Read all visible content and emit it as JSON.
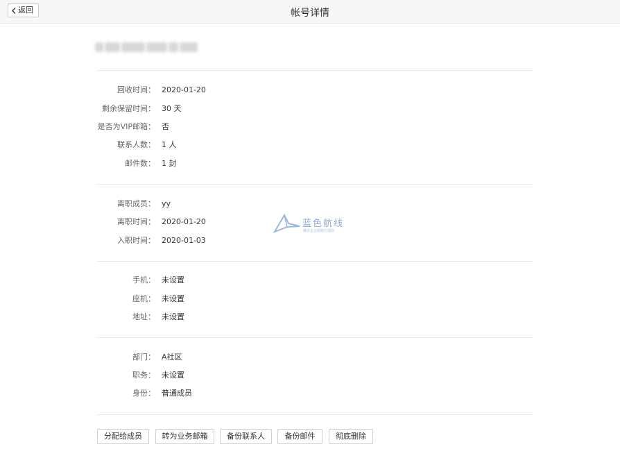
{
  "header": {
    "back_label": "返回",
    "title": "帐号详情"
  },
  "recycle": [
    {
      "label": "回收时间：",
      "value": "2020-01-20"
    },
    {
      "label": "剩余保留时间：",
      "value": "30 天"
    },
    {
      "label": "是否为VIP邮箱：",
      "value": "否"
    },
    {
      "label": "联系人数：",
      "value": "1 人"
    },
    {
      "label": "邮件数：",
      "value": "1 封"
    }
  ],
  "employment": [
    {
      "label": "离职成员：",
      "value": "yy"
    },
    {
      "label": "离职时间：",
      "value": "2020-01-20"
    },
    {
      "label": "入职时间：",
      "value": "2020-01-03"
    }
  ],
  "contact": [
    {
      "label": "手机：",
      "value": "未设置"
    },
    {
      "label": "座机：",
      "value": "未设置"
    },
    {
      "label": "地址：",
      "value": "未设置"
    }
  ],
  "org": [
    {
      "label": "部门：",
      "value": "A社区"
    },
    {
      "label": "职务：",
      "value": "未设置"
    },
    {
      "label": "身份：",
      "value": "普通成员"
    }
  ],
  "actions": {
    "assign": "分配给成员",
    "to_business": "转为业务邮箱",
    "backup_contacts": "备份联系人",
    "backup_mail": "备份邮件",
    "delete": "彻底删除"
  },
  "watermark": {
    "title": "蓝色航线",
    "subtitle": "腾讯企业邮箱代理商"
  }
}
